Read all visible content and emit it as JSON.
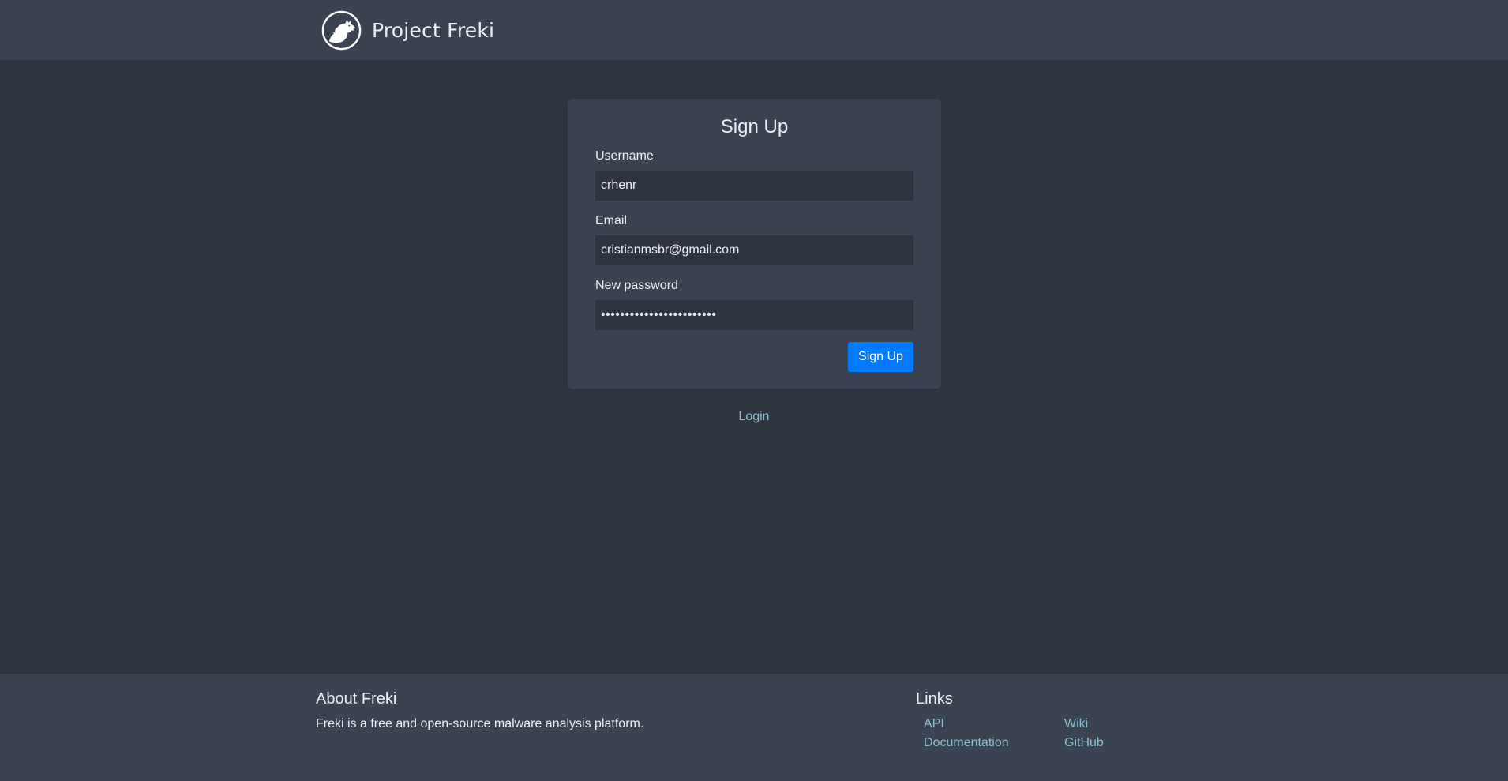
{
  "navbar": {
    "title": "Project Freki",
    "logo_icon": "wolf-logo-icon"
  },
  "signup_form": {
    "title": "Sign Up",
    "username": {
      "label": "Username",
      "value": "crhenr"
    },
    "email": {
      "label": "Email",
      "value": "cristianmsbr@gmail.com"
    },
    "password": {
      "label": "New password",
      "value": "••••••••••••••••••••••••"
    },
    "submit_label": "Sign Up"
  },
  "login_link": "Login",
  "footer": {
    "about": {
      "title": "About Freki",
      "text": "Freki is a free and open-source malware analysis platform."
    },
    "links": {
      "title": "Links",
      "items": [
        "API",
        "Documentation",
        "Wiki",
        "GitHub"
      ]
    }
  },
  "colors": {
    "background": "#2e3440",
    "panel": "#3b4252",
    "text": "#eceff4",
    "link": "#88c0d0",
    "primary_button": "#007bff"
  }
}
